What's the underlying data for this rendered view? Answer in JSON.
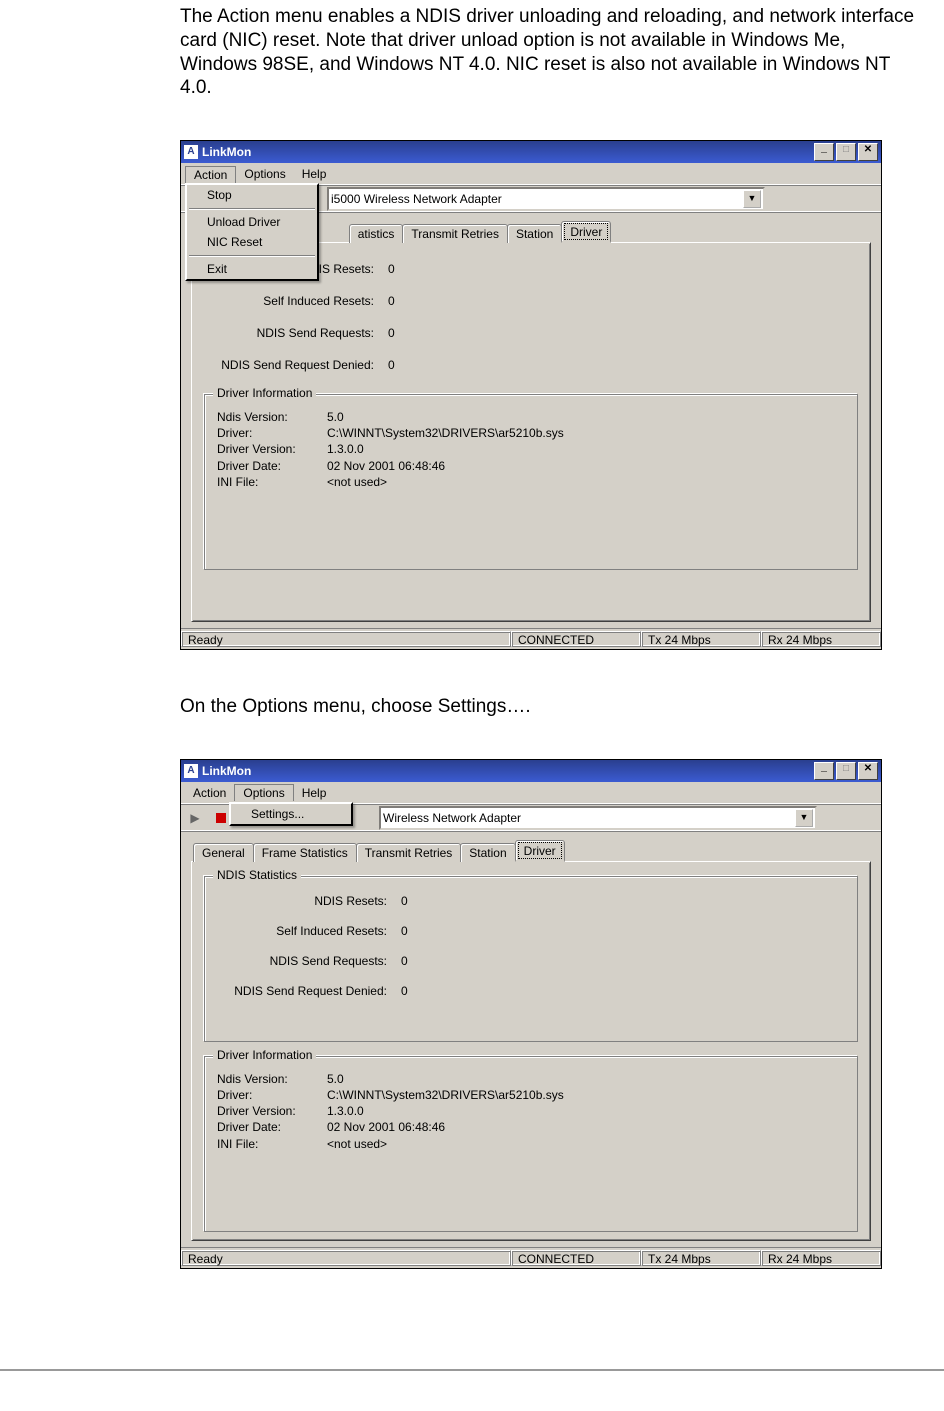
{
  "paragraphs": {
    "p1": "The Action menu enables a NDIS driver unloading and reloading, and network interface card (NIC) reset. Note that driver unload option is not available in Windows Me, Windows 98SE, and Windows NT 4.0. NIC reset is also not available in Windows NT 4.0.",
    "p2": "On the Options menu, choose Settings…."
  },
  "window": {
    "title": "LinkMon",
    "menus": {
      "action": "Action",
      "options": "Options",
      "help": "Help"
    }
  },
  "action_menu": {
    "items": [
      "Stop",
      "Unload Driver",
      "NIC Reset",
      "Exit"
    ]
  },
  "options_menu": {
    "items": [
      "Settings..."
    ]
  },
  "adapter": {
    "win1_text": "i5000 Wireless Network Adapter",
    "win2_text": "Wireless Network Adapter"
  },
  "tabs": [
    "General",
    "Frame Statistics",
    "Transmit Retries",
    "Station",
    "Driver"
  ],
  "active_tab": "Driver",
  "ndis": {
    "group": "NDIS Statistics",
    "rows": {
      "resets_label": "NDIS Resets:",
      "resets_val": "0",
      "self_label": "Self Induced Resets:",
      "self_val": "0",
      "send_label": "NDIS Send Requests:",
      "send_val": "0",
      "denied_label": "NDIS Send Request Denied:",
      "denied_val": "0"
    }
  },
  "drv": {
    "group": "Driver Information",
    "rows": {
      "nv_label": "Ndis Version:",
      "nv_val": "5.0",
      "d_label": "Driver:",
      "d_val": "C:\\WINNT\\System32\\DRIVERS\\ar5210b.sys",
      "dv_label": "Driver Version:",
      "dv_val": "1.3.0.0",
      "dd_label": "Driver Date:",
      "dd_val": "02 Nov 2001 06:48:46",
      "ini_label": "INI File:",
      "ini_val": "<not used>"
    }
  },
  "statusbar": {
    "ready": "Ready",
    "conn": "CONNECTED",
    "tx": "Tx 24 Mbps",
    "rx": "Rx 24 Mbps"
  },
  "winbtns": {
    "min": "_",
    "max": "□",
    "close": "✕"
  }
}
